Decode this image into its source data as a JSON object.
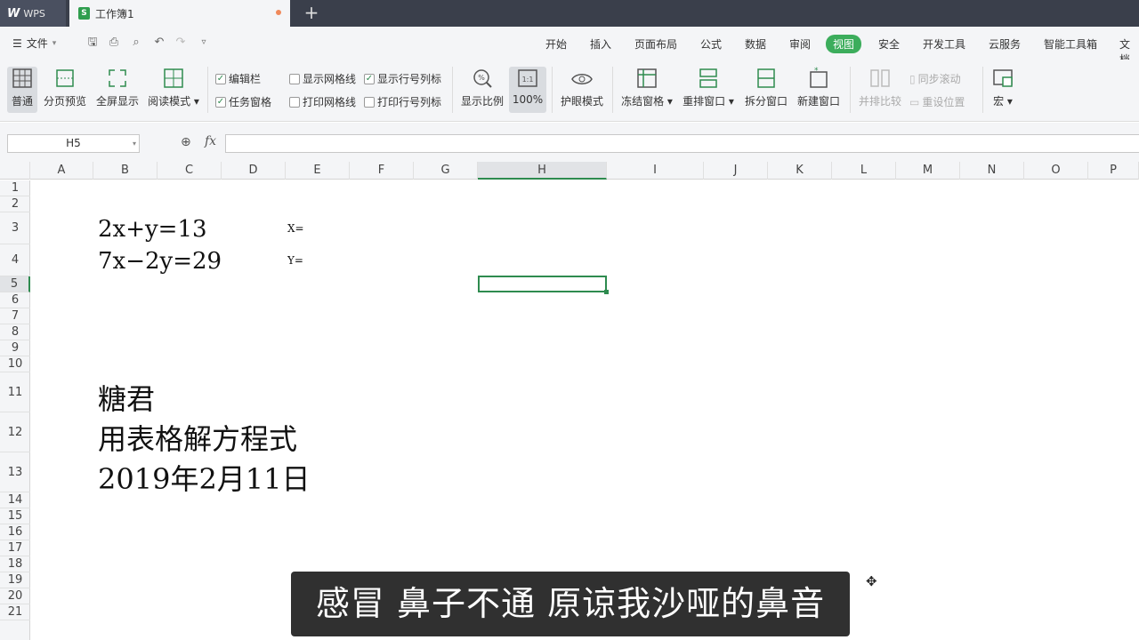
{
  "titlebar": {
    "app_label": "WPS",
    "doc_tab": "工作簿1",
    "new_tab": "+"
  },
  "menubar": {
    "file_label": "文件",
    "items": [
      "开始",
      "插入",
      "页面布局",
      "公式",
      "数据",
      "审阅",
      "视图",
      "安全",
      "开发工具",
      "云服务",
      "智能工具箱",
      "文档"
    ],
    "active": "视图"
  },
  "ribbon": {
    "view_buttons": [
      "普通",
      "分页预览",
      "全屏显示",
      "阅读模式"
    ],
    "checkboxes": [
      {
        "label": "编辑栏",
        "checked": true
      },
      {
        "label": "任务窗格",
        "checked": true
      },
      {
        "label": "显示网格线",
        "checked": false
      },
      {
        "label": "打印网格线",
        "checked": false
      },
      {
        "label": "显示行号列标",
        "checked": true
      },
      {
        "label": "打印行号列标",
        "checked": false
      }
    ],
    "zoom_buttons": [
      "显示比例",
      "100%"
    ],
    "eye_mode": "护眼模式",
    "window_buttons": [
      "冻结窗格",
      "重排窗口",
      "拆分窗口",
      "新建窗口"
    ],
    "compare_buttons": [
      "并排比较",
      "同步滚动",
      "重设位置"
    ],
    "macro": "宏"
  },
  "formulabar": {
    "cell_ref": "H5",
    "fx_label": "fx",
    "formula": ""
  },
  "grid": {
    "columns": [
      "A",
      "B",
      "C",
      "D",
      "E",
      "F",
      "G",
      "H",
      "I",
      "J",
      "K",
      "L",
      "M",
      "N",
      "O",
      "P"
    ],
    "rows": [
      "1",
      "2",
      "3",
      "4",
      "5",
      "6",
      "7",
      "8",
      "9",
      "10",
      "11",
      "12",
      "13",
      "14",
      "15",
      "16",
      "17",
      "18",
      "19",
      "20",
      "21"
    ],
    "selected_column": "H",
    "selected_row": "5"
  },
  "cells": {
    "eq1": "2x+y=13",
    "eq2": "7x−2y=29",
    "x_label": "X=",
    "y_label": "Y=",
    "author": "糖君",
    "topic": "用表格解方程式",
    "date": "2019年2月11日"
  },
  "subtitle": "感冒 鼻子不通 原谅我沙哑的鼻音",
  "colors": {
    "accent": "#2e8b4f",
    "active_tab": "#3cad5c",
    "titlebar": "#3a3f4b"
  }
}
